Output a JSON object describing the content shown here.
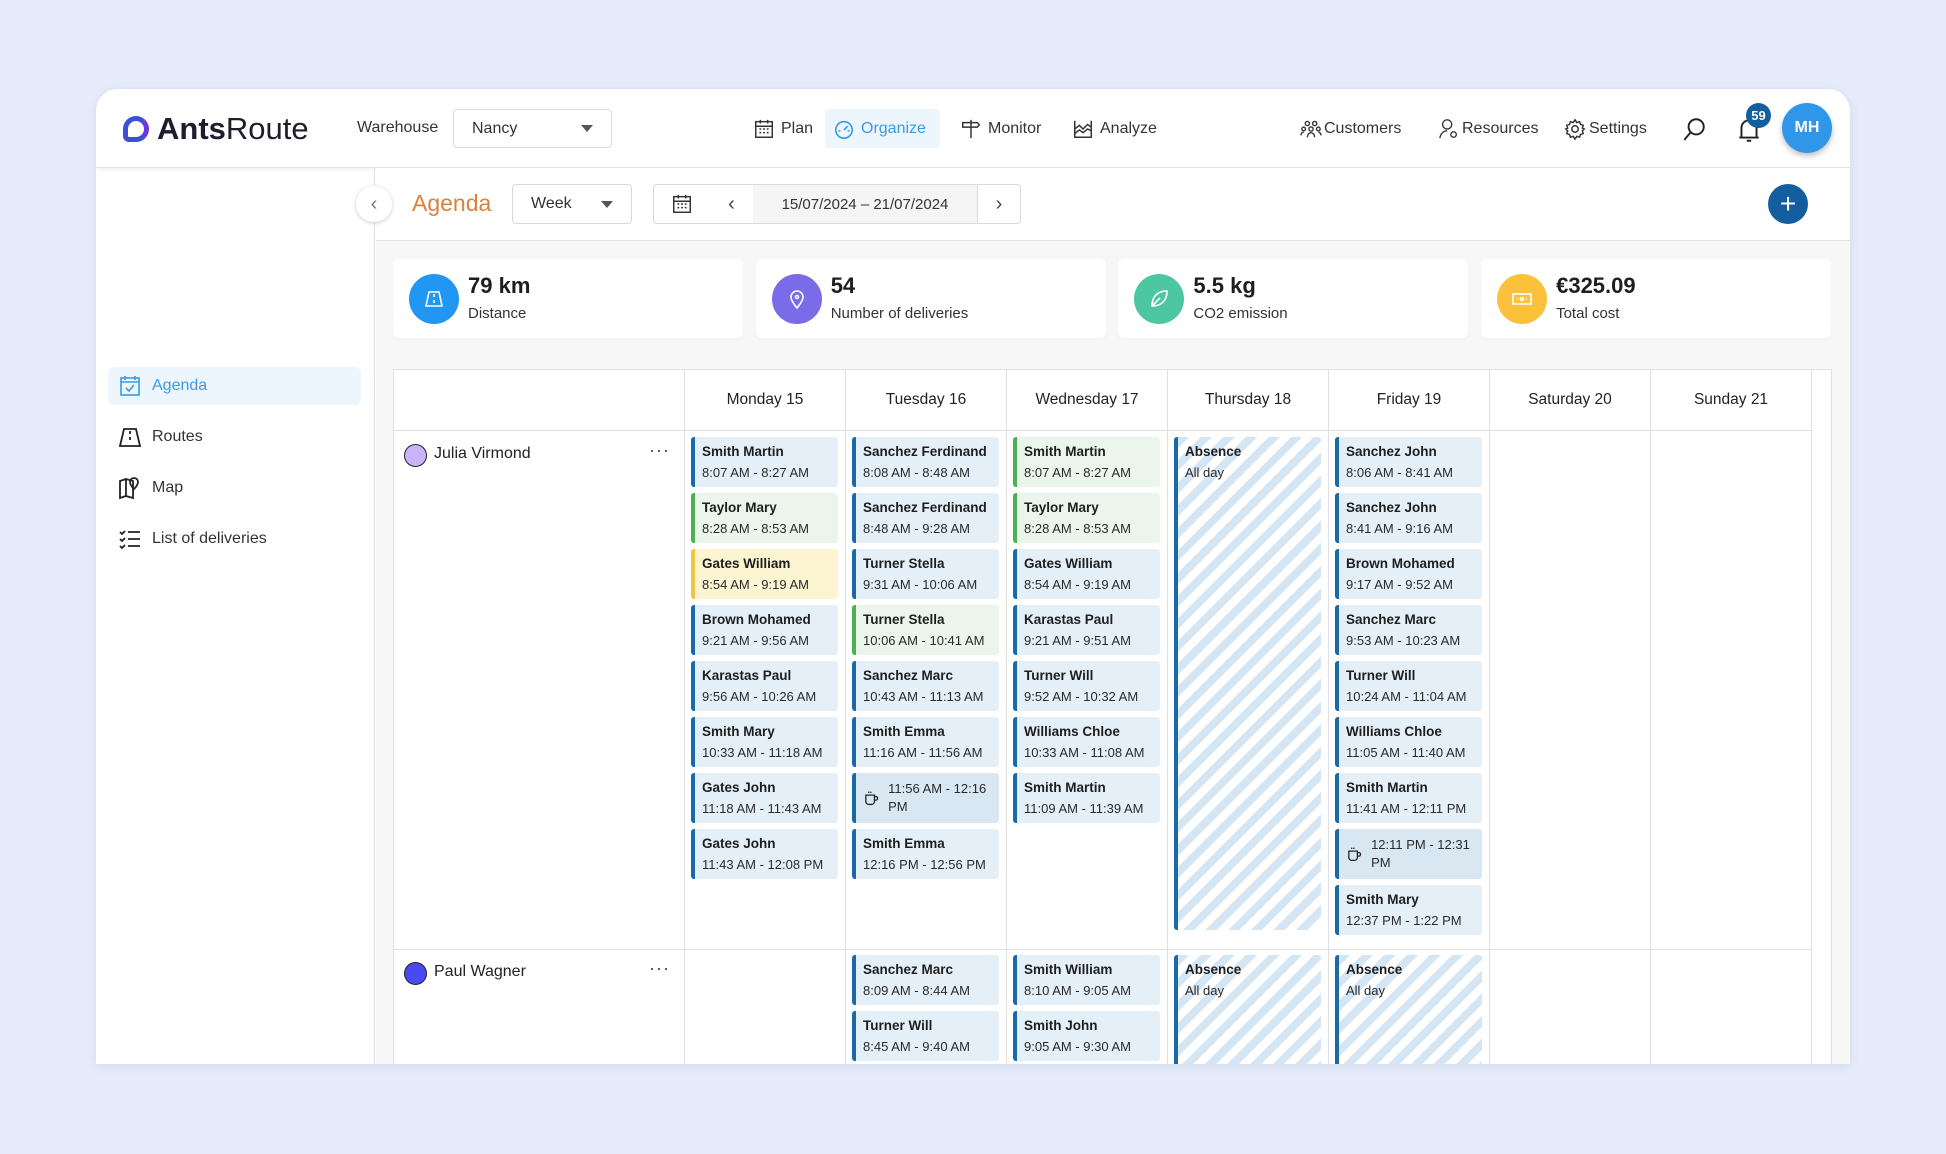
{
  "app": {
    "name_bold": "Ants",
    "name_light": "Route"
  },
  "header": {
    "warehouse_label": "Warehouse",
    "warehouse_value": "Nancy",
    "nav": [
      {
        "label": "Plan",
        "icon": "calendar-icon"
      },
      {
        "label": "Organize",
        "icon": "gauge-icon",
        "active": true
      },
      {
        "label": "Monitor",
        "icon": "signpost-icon"
      },
      {
        "label": "Analyze",
        "icon": "chart-icon"
      }
    ],
    "right_nav": [
      {
        "label": "Customers",
        "icon": "customers-icon"
      },
      {
        "label": "Resources",
        "icon": "resources-icon"
      },
      {
        "label": "Settings",
        "icon": "gear-icon"
      }
    ],
    "notifications": "59",
    "avatar": "MH"
  },
  "sidebar": {
    "items": [
      {
        "label": "Agenda",
        "icon": "calendar-check-icon",
        "active": true
      },
      {
        "label": "Routes",
        "icon": "road-icon"
      },
      {
        "label": "Map",
        "icon": "map-icon"
      },
      {
        "label": "List of deliveries",
        "icon": "checklist-icon"
      }
    ]
  },
  "toolbar": {
    "title": "Agenda",
    "view": "Week",
    "date_range": "15/07/2024 – 21/07/2024"
  },
  "stats": [
    {
      "value": "79 km",
      "label": "Distance",
      "color": "#2196f3",
      "icon": "road-icon"
    },
    {
      "value": "54",
      "label": "Number of deliveries",
      "color": "#7a6be8",
      "icon": "pin-icon"
    },
    {
      "value": "5.5 kg",
      "label": "CO2 emission",
      "color": "#4cc79f",
      "icon": "leaf-icon"
    },
    {
      "value": "€325.09",
      "label": "Total cost",
      "color": "#fbc13a",
      "icon": "money-icon"
    }
  ],
  "colors": {
    "accent": "#3a9be6",
    "event_blue": "#1a6aa8",
    "event_green": "#4caf50",
    "event_yellow": "#f2c53d",
    "title": "#d9813f"
  },
  "days": [
    "Monday 15",
    "Tuesday 16",
    "Wednesday 17",
    "Thursday 18",
    "Friday 19",
    "Saturday 20",
    "Sunday 21"
  ],
  "resources": [
    {
      "name": "Julia Virmond",
      "color": "#c8b4f6",
      "days": [
        [
          {
            "n": "Smith Martin",
            "t": "8:07 AM - 8:27 AM"
          },
          {
            "n": "Taylor Mary",
            "t": "8:28 AM - 8:53 AM",
            "s": "green"
          },
          {
            "n": "Gates William",
            "t": "8:54 AM - 9:19 AM",
            "s": "yellow"
          },
          {
            "n": "Brown Mohamed",
            "t": "9:21 AM - 9:56 AM"
          },
          {
            "n": "Karastas Paul",
            "t": "9:56 AM - 10:26 AM"
          },
          {
            "n": "Smith Mary",
            "t": "10:33 AM - 11:18 AM"
          },
          {
            "n": "Gates John",
            "t": "11:18 AM - 11:43 AM"
          },
          {
            "n": "Gates John",
            "t": "11:43 AM - 12:08 PM"
          }
        ],
        [
          {
            "n": "Sanchez Ferdinand",
            "t": "8:08 AM - 8:48 AM"
          },
          {
            "n": "Sanchez Ferdinand",
            "t": "8:48 AM - 9:28 AM"
          },
          {
            "n": "Turner Stella",
            "t": "9:31 AM - 10:06 AM"
          },
          {
            "n": "Turner Stella",
            "t": "10:06 AM - 10:41 AM",
            "s": "green"
          },
          {
            "n": "Sanchez Marc",
            "t": "10:43 AM - 11:13 AM"
          },
          {
            "n": "Smith Emma",
            "t": "11:16 AM - 11:56 AM"
          },
          {
            "t": "11:56 AM - 12:16 PM",
            "s": "brk"
          },
          {
            "n": "Smith Emma",
            "t": "12:16 PM - 12:56 PM"
          }
        ],
        [
          {
            "n": "Smith Martin",
            "t": "8:07 AM - 8:27 AM",
            "s": "green"
          },
          {
            "n": "Taylor Mary",
            "t": "8:28 AM - 8:53 AM",
            "s": "green"
          },
          {
            "n": "Gates William",
            "t": "8:54 AM - 9:19 AM"
          },
          {
            "n": "Karastas Paul",
            "t": "9:21 AM - 9:51 AM"
          },
          {
            "n": "Turner Will",
            "t": "9:52 AM - 10:32 AM"
          },
          {
            "n": "Williams Chloe",
            "t": "10:33 AM - 11:08 AM"
          },
          {
            "n": "Smith Martin",
            "t": "11:09 AM - 11:39 AM"
          }
        ],
        [
          {
            "n": "Absence",
            "t": "All day",
            "s": "absence"
          }
        ],
        [
          {
            "n": "Sanchez John",
            "t": "8:06 AM - 8:41 AM"
          },
          {
            "n": "Sanchez John",
            "t": "8:41 AM - 9:16 AM"
          },
          {
            "n": "Brown Mohamed",
            "t": "9:17 AM - 9:52 AM"
          },
          {
            "n": "Sanchez Marc",
            "t": "9:53 AM - 10:23 AM"
          },
          {
            "n": "Turner Will",
            "t": "10:24 AM - 11:04 AM"
          },
          {
            "n": "Williams Chloe",
            "t": "11:05 AM - 11:40 AM"
          },
          {
            "n": "Smith Martin",
            "t": "11:41 AM - 12:11 PM"
          },
          {
            "t": "12:11 PM - 12:31 PM",
            "s": "brk"
          },
          {
            "n": "Smith Mary",
            "t": "12:37 PM - 1:22 PM"
          }
        ],
        [],
        []
      ]
    },
    {
      "name": "Paul Wagner",
      "color": "#4a4af2",
      "days": [
        [],
        [
          {
            "n": "Sanchez Marc",
            "t": "8:09 AM - 8:44 AM"
          },
          {
            "n": "Turner Will",
            "t": "8:45 AM - 9:40 AM"
          }
        ],
        [
          {
            "n": "Smith William",
            "t": "8:10 AM - 9:05 AM"
          },
          {
            "n": "Smith John",
            "t": "9:05 AM - 9:30 AM"
          }
        ],
        [
          {
            "n": "Absence",
            "t": "All day",
            "s": "absence"
          }
        ],
        [
          {
            "n": "Absence",
            "t": "All day",
            "s": "absence"
          }
        ],
        [],
        []
      ]
    }
  ]
}
